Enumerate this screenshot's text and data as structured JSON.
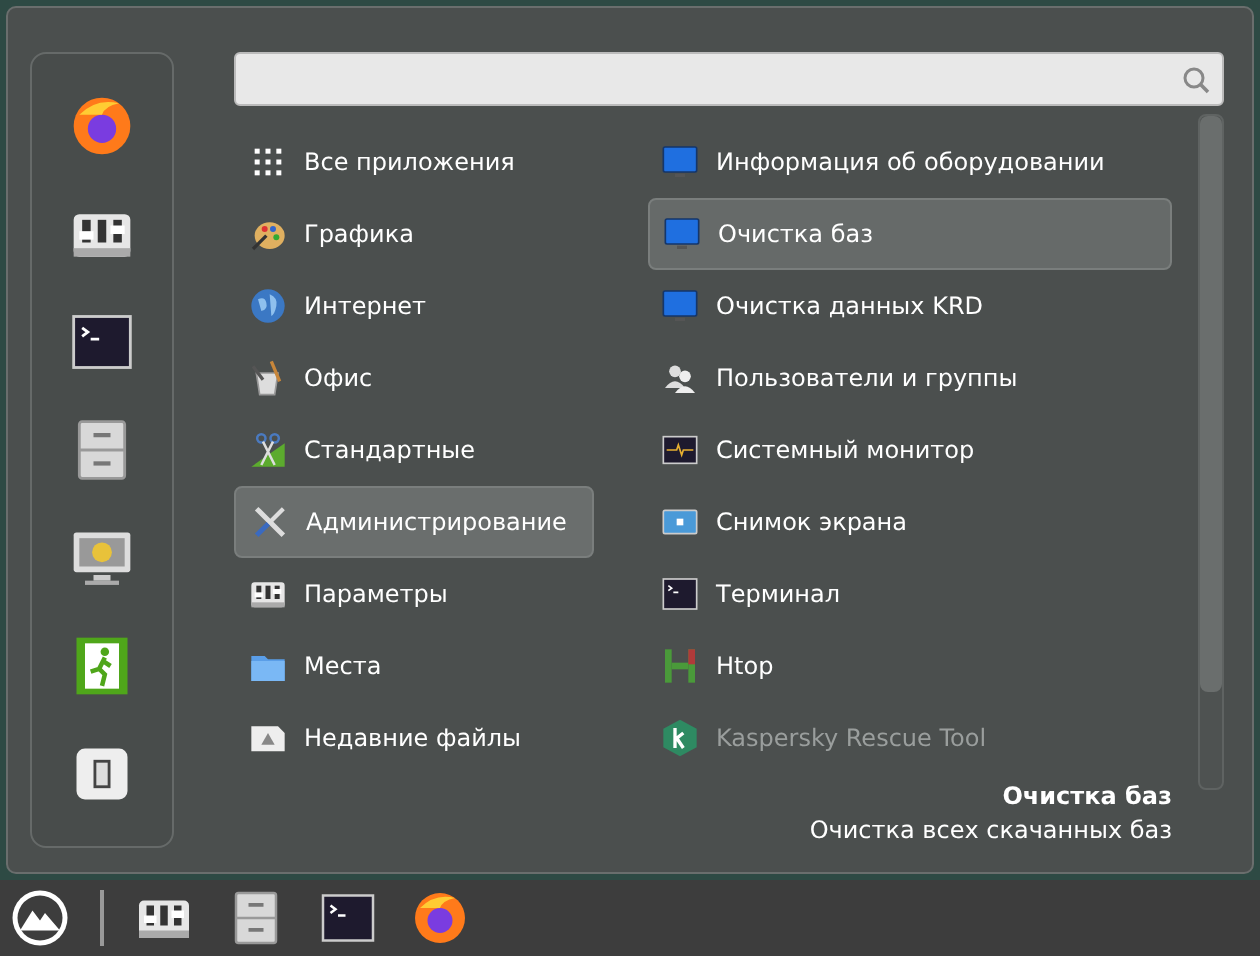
{
  "favorites": [
    {
      "kind": "firefox"
    },
    {
      "kind": "settings"
    },
    {
      "kind": "terminal"
    },
    {
      "kind": "files"
    },
    {
      "kind": "lock-screen"
    },
    {
      "kind": "logout"
    },
    {
      "kind": "power"
    }
  ],
  "categories": [
    {
      "label": "Все приложения",
      "kind": "grid",
      "selected": false
    },
    {
      "label": "Графика",
      "kind": "palette",
      "selected": false
    },
    {
      "label": "Интернет",
      "kind": "globe",
      "selected": false
    },
    {
      "label": "Офис",
      "kind": "office",
      "selected": false
    },
    {
      "label": "Стандартные",
      "kind": "accessories",
      "selected": false
    },
    {
      "label": "Администрирование",
      "kind": "tools",
      "selected": true
    },
    {
      "label": "Параметры",
      "kind": "settings",
      "selected": false
    },
    {
      "label": "Места",
      "kind": "folder",
      "selected": false
    },
    {
      "label": "Недавние файлы",
      "kind": "recent",
      "selected": false
    }
  ],
  "apps": [
    {
      "label": "Информация об оборудовании",
      "kind": "monitor",
      "selected": false,
      "disabled": false
    },
    {
      "label": "Очистка баз",
      "kind": "monitor",
      "selected": true,
      "disabled": false
    },
    {
      "label": "Очистка данных KRD",
      "kind": "monitor",
      "selected": false,
      "disabled": false
    },
    {
      "label": "Пользователи и группы",
      "kind": "users",
      "selected": false,
      "disabled": false
    },
    {
      "label": "Системный монитор",
      "kind": "sysmon",
      "selected": false,
      "disabled": false
    },
    {
      "label": "Снимок экрана",
      "kind": "screenshot",
      "selected": false,
      "disabled": false
    },
    {
      "label": "Терминал",
      "kind": "terminal",
      "selected": false,
      "disabled": false
    },
    {
      "label": "Htop",
      "kind": "htop",
      "selected": false,
      "disabled": false
    },
    {
      "label": "Kaspersky Rescue Tool",
      "kind": "kaspersky",
      "selected": false,
      "disabled": true
    }
  ],
  "description": {
    "title": "Очистка баз",
    "text": "Очистка всех скачанных баз"
  },
  "taskbar": [
    {
      "kind": "menu"
    },
    {
      "kind": "settings"
    },
    {
      "kind": "files"
    },
    {
      "kind": "terminal"
    },
    {
      "kind": "firefox"
    }
  ]
}
